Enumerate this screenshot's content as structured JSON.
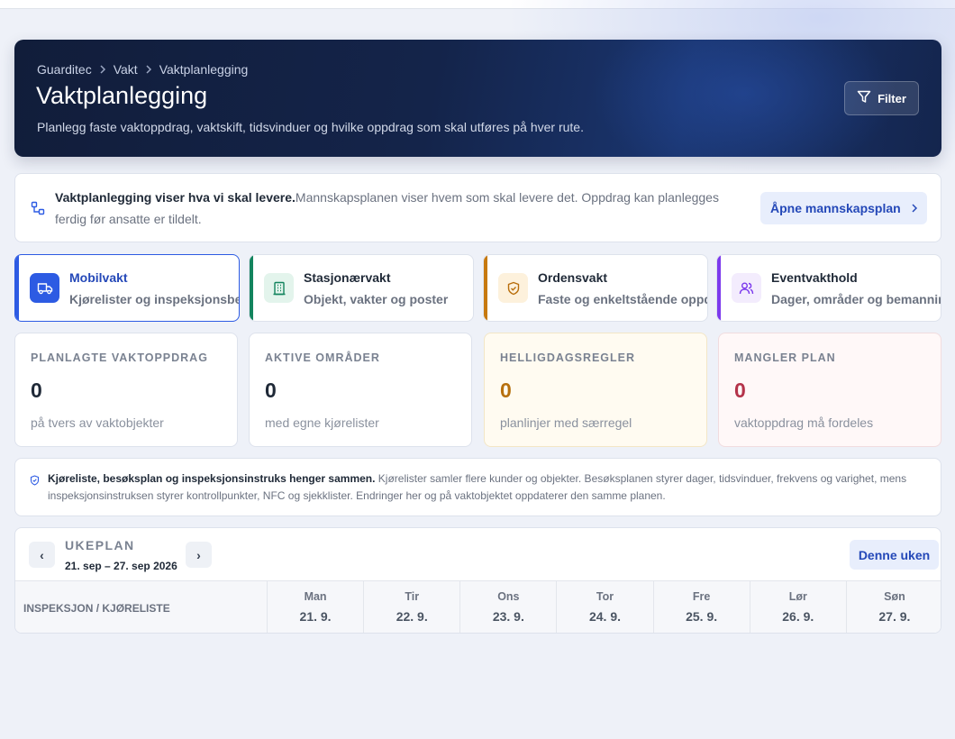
{
  "hero": {
    "breadcrumb": [
      "Guarditec",
      "Vakt",
      "Vaktplanlegging"
    ],
    "title": "Vaktplanlegging",
    "subtitle": "Planlegg faste vaktoppdrag, vaktskift, tidsvinduer og hvilke oppdrag som skal utføres på hver rute.",
    "filter_label": "Filter"
  },
  "info": {
    "bold": "Vaktplanlegging viser hva vi skal levere.",
    "text": "Mannskapsplanen viser hvem som skal levere det. Oppdrag kan planlegges ferdig før ansatte er tildelt.",
    "button_label": "Åpne mannskapsplan"
  },
  "types": [
    {
      "title": "Mobilvakt",
      "subtitle": "Kjørelister og inspeksjonsbesøk",
      "color": "#2d5be3",
      "icon": "truck-icon"
    },
    {
      "title": "Stasjonærvakt",
      "subtitle": "Objekt, vakter og poster",
      "color": "#13845e",
      "icon": "building-icon"
    },
    {
      "title": "Ordensvakt",
      "subtitle": "Faste og enkeltstående oppdrag",
      "color": "#c7790f",
      "icon": "shield-icon"
    },
    {
      "title": "Eventvakthold",
      "subtitle": "Dager, områder og bemanning",
      "color": "#7c3aed",
      "icon": "users-icon"
    }
  ],
  "stats": [
    {
      "label": "PLANLAGTE VAKTOPPDRAG",
      "value": "0",
      "sub": "på tvers av vaktobjekter",
      "color": "#1f2937"
    },
    {
      "label": "AKTIVE OMRÅDER",
      "value": "0",
      "sub": "med egne kjørelister",
      "color": "#1f2937"
    },
    {
      "label": "HELLIGDAGSREGLER",
      "value": "0",
      "sub": "planlinjer med særregel",
      "color": "#b7700e"
    },
    {
      "label": "MANGLER PLAN",
      "value": "0",
      "sub": "vaktoppdrag må fordeles",
      "color": "#b4334a"
    }
  ],
  "note": {
    "bold": "Kjøreliste, besøksplan og inspeksjonsinstruks henger sammen.",
    "text": "Kjørelister samler flere kunder og objekter. Besøksplanen styrer dager, tidsvinduer, frekvens og varighet, mens inspeksjonsinstruksen styrer kontrollpunkter, NFC og sjekklister. Endringer her og på vaktobjektet oppdaterer den samme planen."
  },
  "week": {
    "label": "UKEPLAN",
    "range": "21. sep – 27. sep 2026",
    "prev": "‹",
    "next": "›",
    "this_week": "Denne uken",
    "first_column": "INSPEKSJON / KJØRELISTE",
    "days": [
      {
        "name": "Man",
        "date": "21. 9."
      },
      {
        "name": "Tir",
        "date": "22. 9."
      },
      {
        "name": "Ons",
        "date": "23. 9."
      },
      {
        "name": "Tor",
        "date": "24. 9."
      },
      {
        "name": "Fre",
        "date": "25. 9."
      },
      {
        "name": "Lør",
        "date": "26. 9."
      },
      {
        "name": "Søn",
        "date": "27. 9."
      }
    ]
  }
}
